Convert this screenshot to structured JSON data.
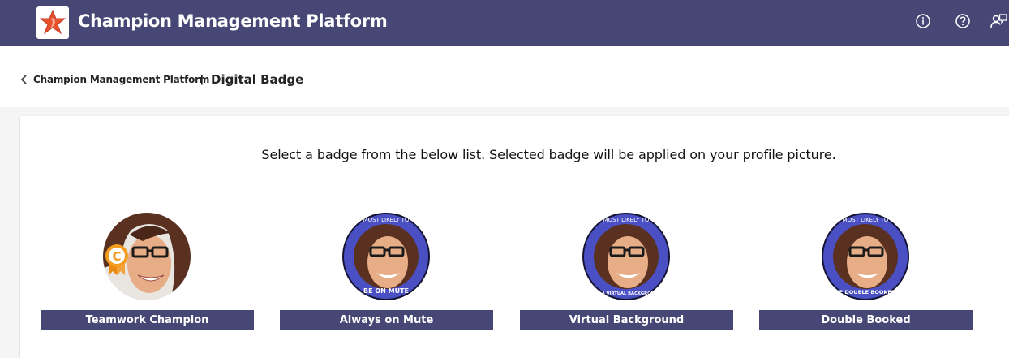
{
  "header": {
    "app_title": "Champion Management Platform",
    "icons": [
      "info-icon",
      "help-icon",
      "feedback-icon"
    ]
  },
  "breadcrumb": {
    "parent": "Champion Management Platform",
    "separator": "|",
    "current": "Digital Badge"
  },
  "main": {
    "instruction": "Select a badge from the below list. Selected badge will be applied on your profile picture."
  },
  "badges": [
    {
      "label": "Teamwork Champion"
    },
    {
      "label": "Always on Mute",
      "ring_top": "MOST LIKELY TO",
      "ring_bottom": "BE ON MUTE"
    },
    {
      "label": "Virtual Background",
      "ring_top": "MOST LIKELY TO",
      "ring_bottom": "USE A VIRTUAL BACKGROUND"
    },
    {
      "label": "Double Booked",
      "ring_top": "MOST LIKELY TO",
      "ring_bottom": "BE DOUBLE BOOKED"
    }
  ],
  "colors": {
    "brand": "#464775",
    "ring": "#4a4fc4",
    "champion_badge": "#f39c1f",
    "logo_star": "#e8522a"
  }
}
